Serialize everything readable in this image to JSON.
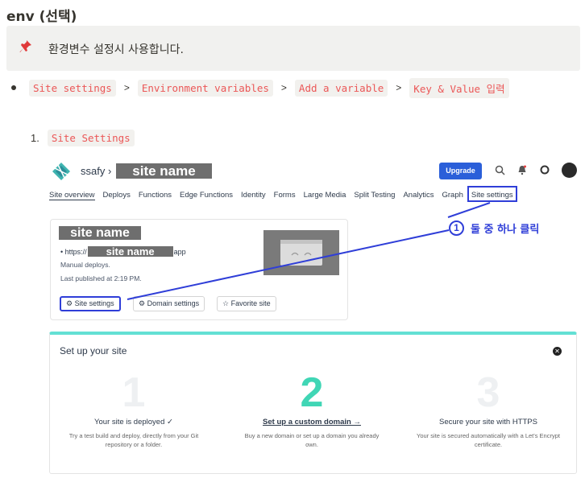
{
  "heading": "env (선택)",
  "callout": {
    "icon": "pushpin-icon",
    "text": "환경변수 설정시 사용합니다."
  },
  "breadcrumb": {
    "items": [
      "Site settings",
      "Environment variables",
      "Add a variable",
      "Key & Value 입력"
    ],
    "separator": ">"
  },
  "step1": {
    "number": "1.",
    "label": "Site Settings"
  },
  "screenshot": {
    "team": "ssafy",
    "team_chevron": "›",
    "site_name_redacted": "site name",
    "upgrade": "Upgrade",
    "nav": [
      "Site overview",
      "Deploys",
      "Functions",
      "Edge Functions",
      "Identity",
      "Forms",
      "Large Media",
      "Split Testing",
      "Analytics",
      "Graph",
      "Site settings"
    ],
    "annotation": {
      "marker": "1",
      "text": "둘 중 하나 클릭"
    },
    "card": {
      "title_redacted": "site name",
      "url_prefix": "• https://",
      "url_redacted": "site name",
      "url_suffix": "app",
      "meta1": "Manual deploys.",
      "meta2": "Last published at 2:19 PM.",
      "buttons": [
        "Site settings",
        "Domain settings",
        "Favorite site"
      ],
      "button_icons": [
        "gear-icon",
        "globe-icon",
        "star-icon"
      ]
    },
    "setup": {
      "title": "Set up your site",
      "steps": [
        {
          "num": "1",
          "heading": "Your site is deployed ✓",
          "desc": "Try a test build and deploy, directly from your Git repository or a folder."
        },
        {
          "num": "2",
          "heading": "Set up a custom domain →",
          "desc": "Buy a new domain or set up a domain you already own."
        },
        {
          "num": "3",
          "heading": "Secure your site with HTTPS",
          "desc": "Your site is secured automatically with a Let's Encrypt certificate."
        }
      ]
    },
    "colors": {
      "annotation": "#2f3ed8",
      "upgrade": "#2b5fd9",
      "setup_accent": "#63e0d4",
      "step2": "#40d6b5"
    }
  }
}
